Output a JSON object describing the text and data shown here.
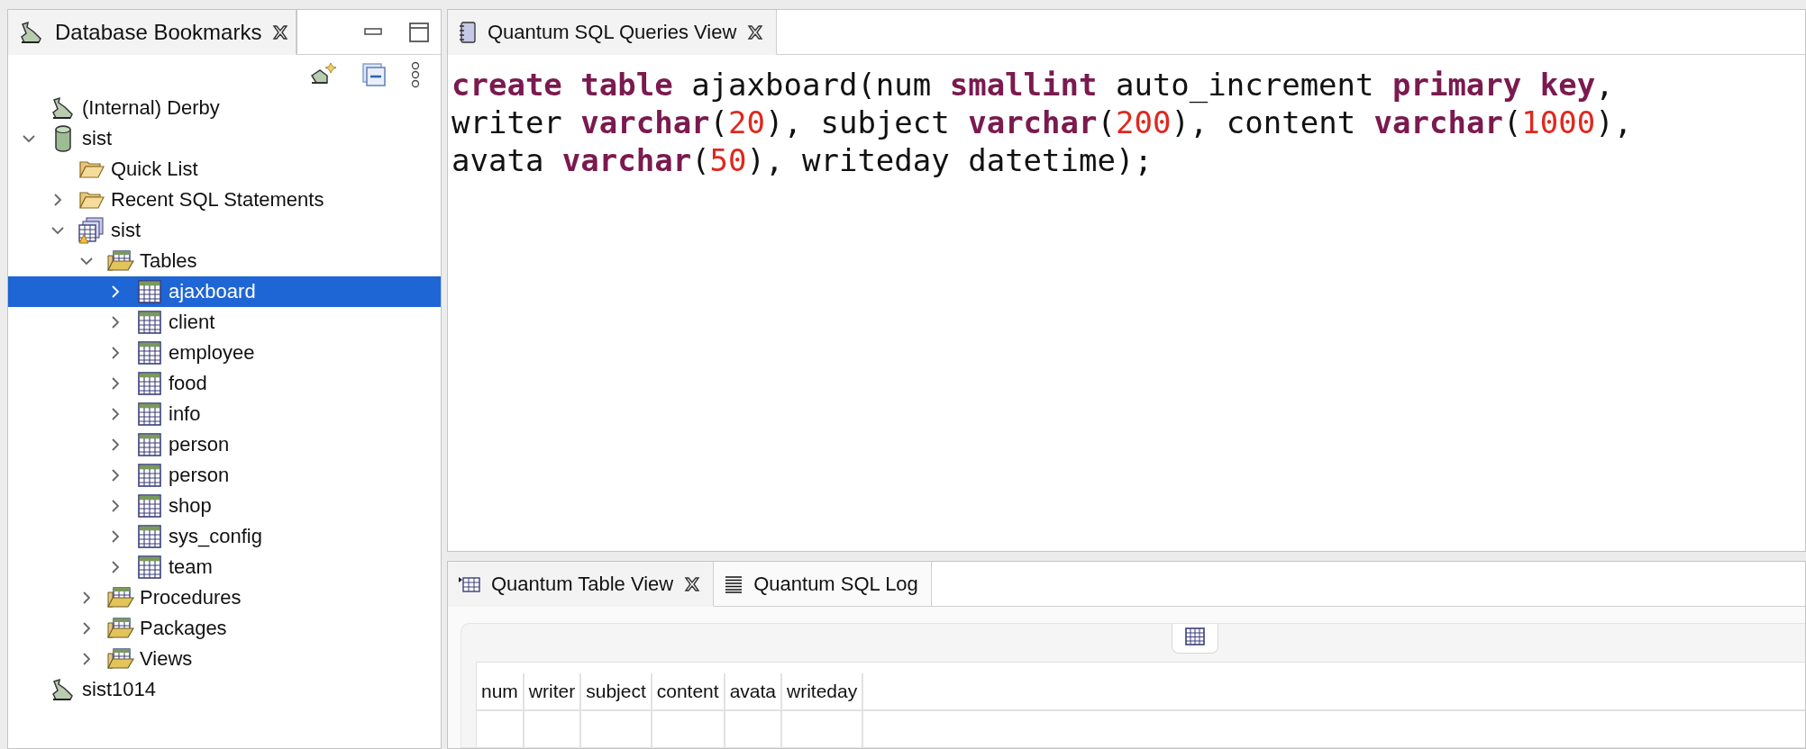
{
  "bookmarks_panel": {
    "tab": {
      "label": "Database Bookmarks"
    },
    "tree": [
      {
        "label": "(Internal) Derby",
        "kind": "bookmark",
        "selected": false
      },
      {
        "label": "sist",
        "kind": "database",
        "expanded": true,
        "selected": false,
        "children": [
          {
            "label": "Quick List",
            "kind": "folder",
            "selected": false
          },
          {
            "label": "Recent SQL Statements",
            "kind": "folder",
            "expanded": false,
            "selected": false
          },
          {
            "label": "sist",
            "kind": "schema",
            "expanded": true,
            "selected": false,
            "children": [
              {
                "label": "Tables",
                "kind": "table_folder",
                "expanded": true,
                "selected": false,
                "children": [
                  {
                    "label": "ajaxboard",
                    "kind": "table",
                    "expanded": false,
                    "selected": true
                  },
                  {
                    "label": "client",
                    "kind": "table",
                    "expanded": false,
                    "selected": false
                  },
                  {
                    "label": "employee",
                    "kind": "table",
                    "expanded": false,
                    "selected": false
                  },
                  {
                    "label": "food",
                    "kind": "table",
                    "expanded": false,
                    "selected": false
                  },
                  {
                    "label": "info",
                    "kind": "table",
                    "expanded": false,
                    "selected": false
                  },
                  {
                    "label": "person",
                    "kind": "table",
                    "expanded": false,
                    "selected": false
                  },
                  {
                    "label": "person",
                    "kind": "table",
                    "expanded": false,
                    "selected": false
                  },
                  {
                    "label": "shop",
                    "kind": "table",
                    "expanded": false,
                    "selected": false
                  },
                  {
                    "label": "sys_config",
                    "kind": "table",
                    "expanded": false,
                    "selected": false
                  },
                  {
                    "label": "team",
                    "kind": "table",
                    "expanded": false,
                    "selected": false
                  }
                ]
              },
              {
                "label": "Procedures",
                "kind": "table_folder",
                "expanded": false,
                "selected": false
              },
              {
                "label": "Packages",
                "kind": "table_folder",
                "expanded": false,
                "selected": false
              },
              {
                "label": "Views",
                "kind": "table_folder",
                "expanded": false,
                "selected": false
              }
            ]
          }
        ]
      },
      {
        "label": "sist1014",
        "kind": "bookmark",
        "selected": false
      }
    ]
  },
  "editor": {
    "tab": {
      "label": "Quantum SQL Queries View"
    },
    "lines": [
      [
        {
          "text": "create",
          "kind": "keyword"
        },
        {
          "text": " table",
          "kind": "keyword"
        },
        {
          "text": " ajaxboard(num ",
          "kind": "plain"
        },
        {
          "text": "smallint",
          "kind": "keyword"
        },
        {
          "text": " auto_increment ",
          "kind": "plain"
        },
        {
          "text": "primary",
          "kind": "keyword"
        },
        {
          "text": " key",
          "kind": "keyword"
        },
        {
          "text": ",",
          "kind": "plain"
        }
      ],
      [
        {
          "text": "writer ",
          "kind": "plain"
        },
        {
          "text": "varchar",
          "kind": "keyword"
        },
        {
          "text": "(",
          "kind": "plain"
        },
        {
          "text": "20",
          "kind": "number"
        },
        {
          "text": "), subject ",
          "kind": "plain"
        },
        {
          "text": "varchar",
          "kind": "keyword"
        },
        {
          "text": "(",
          "kind": "plain"
        },
        {
          "text": "200",
          "kind": "number"
        },
        {
          "text": "), content ",
          "kind": "plain"
        },
        {
          "text": "varchar",
          "kind": "keyword"
        },
        {
          "text": "(",
          "kind": "plain"
        },
        {
          "text": "1000",
          "kind": "number"
        },
        {
          "text": "),",
          "kind": "plain"
        }
      ],
      [
        {
          "text": "avata ",
          "kind": "plain"
        },
        {
          "text": "varchar",
          "kind": "keyword"
        },
        {
          "text": "(",
          "kind": "plain"
        },
        {
          "text": "50",
          "kind": "number"
        },
        {
          "text": "), writeday datetime);",
          "kind": "plain"
        }
      ]
    ]
  },
  "bottom_panel": {
    "tabs": [
      {
        "label": "Quantum Table View",
        "kind": "table_view",
        "selected": true
      },
      {
        "label": "Quantum SQL Log",
        "kind": "log",
        "selected": false
      }
    ],
    "table": {
      "columns": [
        "num",
        "writer",
        "subject",
        "content",
        "avata",
        "writeday"
      ]
    }
  }
}
